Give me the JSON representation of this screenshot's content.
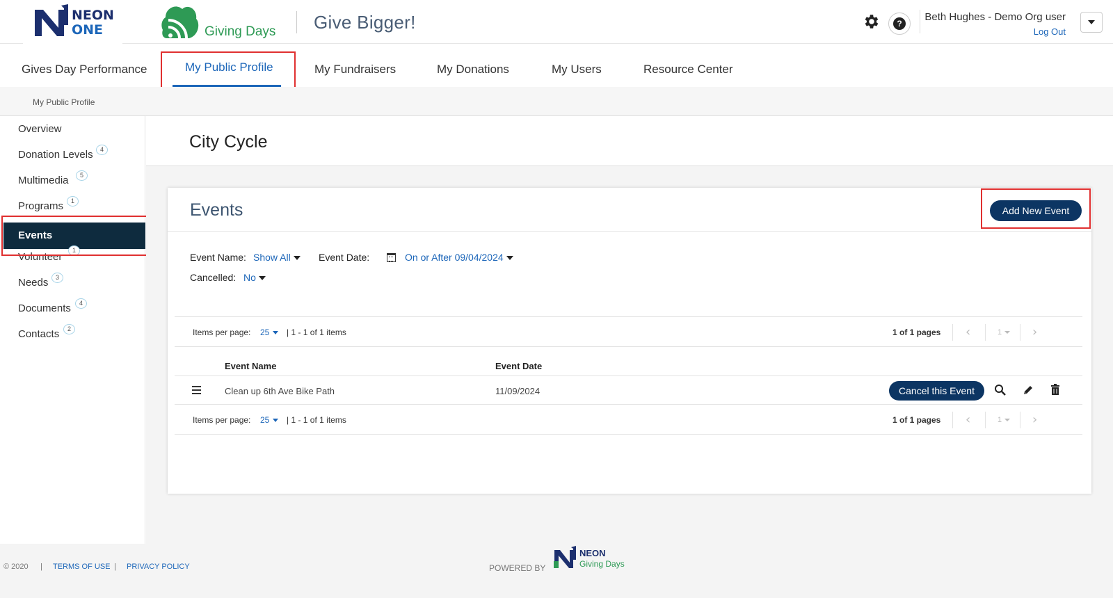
{
  "header": {
    "brand_line1": "NEON",
    "brand_line2": "ONE",
    "product_name": "Giving Days",
    "tagline": "Give Bigger!",
    "user_name": "Beth Hughes - Demo Org user",
    "logout_label": "Log Out",
    "icons": {
      "settings": "gear-icon",
      "help": "help-icon",
      "menu": "chevron-down-icon"
    }
  },
  "nav": {
    "items": [
      {
        "label": "Gives Day Performance"
      },
      {
        "label": "My Public Profile",
        "active": true
      },
      {
        "label": "My Fundraisers"
      },
      {
        "label": "My Donations"
      },
      {
        "label": "My Users"
      },
      {
        "label": "Resource Center"
      }
    ],
    "sub_item": "My Public Profile"
  },
  "sidebar": {
    "items": [
      {
        "label": "Overview",
        "badge": ""
      },
      {
        "label": "Donation Levels",
        "badge": "4"
      },
      {
        "label": "Multimedia",
        "badge": "5"
      },
      {
        "label": "Programs",
        "badge": "1"
      },
      {
        "label": "Events",
        "badge": "",
        "active": true
      },
      {
        "label": "Volunteer",
        "badge": "1"
      },
      {
        "label": "Needs",
        "badge": "3"
      },
      {
        "label": "Documents",
        "badge": "4"
      },
      {
        "label": "Contacts",
        "badge": "2"
      }
    ]
  },
  "page": {
    "title": "City Cycle",
    "card_title": "Events",
    "add_button": "Add New Event"
  },
  "filters": {
    "event_name_label": "Event Name:",
    "event_name_value": "Show All",
    "event_date_label": "Event Date:",
    "event_date_value": "On or After 09/04/2024",
    "cancelled_label": "Cancelled:",
    "cancelled_value": "No"
  },
  "pager": {
    "per_page_label": "Items per page:",
    "per_page_value": "25",
    "range": "| 1 - 1 of 1 items",
    "pages": "1 of 1 pages",
    "current_page": "1"
  },
  "table": {
    "columns": [
      "Event Name",
      "Event Date"
    ],
    "rows": [
      {
        "name": "Clean up 6th Ave Bike Path",
        "date": "11/09/2024",
        "action_label": "Cancel this Event"
      }
    ]
  },
  "footer": {
    "copyright": "© 2020",
    "sep": "|",
    "terms": "TERMS OF USE",
    "privacy": "PRIVACY POLICY",
    "powered_by": "POWERED BY",
    "logo_line1": "NEON",
    "logo_line2": "Giving Days"
  },
  "colors": {
    "brand_navy": "#0c3563",
    "brand_blue": "#1c66b9",
    "brand_green": "#2e9a55",
    "sidebar_active": "#0e2b3e",
    "highlight_red": "#e03030"
  }
}
